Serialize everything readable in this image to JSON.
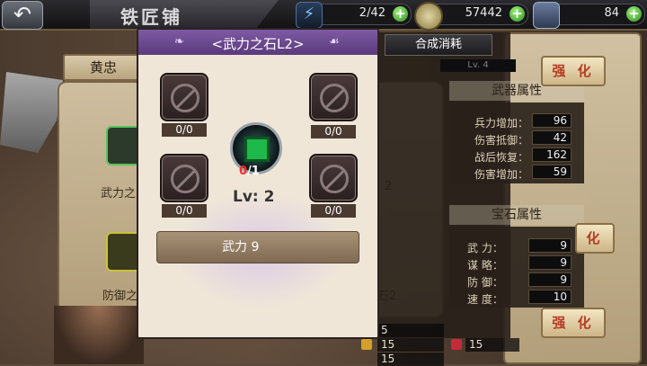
{
  "header": {
    "title": "铁匠铺",
    "resources": [
      {
        "icon": "lightning-icon",
        "value": "2/42"
      },
      {
        "icon": "coin-icon",
        "value": "57442"
      },
      {
        "icon": "gem-pack-icon",
        "value": "84"
      }
    ]
  },
  "background": {
    "hero_name": "黄忠",
    "item_labels": [
      "武力之",
      "防御之"
    ],
    "right_labels": [
      "2",
      "石2"
    ],
    "synthesis_tab": "合成消耗",
    "lv_tag": "Lv. 4",
    "weapon_section": {
      "title": "武器属性",
      "stats": [
        {
          "label": "兵力增加：",
          "value": "96"
        },
        {
          "label": "伤害抵御：",
          "value": "42"
        },
        {
          "label": "战后恢复：",
          "value": "162"
        },
        {
          "label": "伤害增加：",
          "value": "59"
        }
      ]
    },
    "gem_section": {
      "title": "宝石属性",
      "stats": [
        {
          "label": "武 力：",
          "value": "9"
        },
        {
          "label": "谋 略：",
          "value": "9"
        },
        {
          "label": "防 御：",
          "value": "9"
        },
        {
          "label": "速 度：",
          "value": "10"
        }
      ]
    },
    "strengthen_label": "强 化",
    "strengthen_label_2": "化",
    "cost_values": [
      "5",
      "15",
      "15",
      "15"
    ]
  },
  "popup": {
    "title": "<武力之石L2>",
    "slot_counts": [
      "0/0",
      "0/0",
      "0/0",
      "0/0"
    ],
    "gem": {
      "have": "0",
      "need": "/1",
      "icon": "green-gem-icon"
    },
    "level": "Lv: 2",
    "attribute": "武力 9"
  },
  "colors": {
    "accent": "#6a4690",
    "strengthen_text": "#b63b24",
    "plus_green": "#3fa52a"
  }
}
